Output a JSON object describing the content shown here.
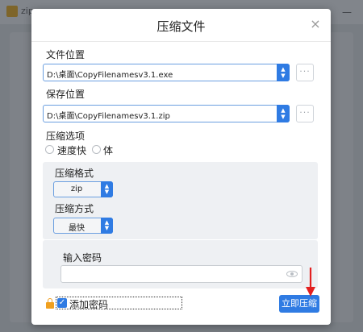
{
  "background": {
    "app_title": "zip"
  },
  "dialog": {
    "title": "压缩文件",
    "close_glyph": "×",
    "file_location": {
      "label": "文件位置",
      "value": "D:\\桌面\\CopyFilenamesv3.1.exe",
      "browse_label": "···"
    },
    "save_location": {
      "label": "保存位置",
      "value": "D:\\桌面\\CopyFilenamesv3.1.zip",
      "browse_label": "···"
    },
    "options": {
      "label": "压缩选项",
      "radio_fast": "速度快",
      "radio_small": "体"
    },
    "format": {
      "label": "压缩格式",
      "value": "zip"
    },
    "method": {
      "label": "压缩方式",
      "value": "最快"
    },
    "password": {
      "label": "输入密码",
      "value": ""
    },
    "add_password": {
      "label": "添加密码",
      "checked": true
    },
    "compress_button": "立即压缩"
  },
  "colors": {
    "accent": "#2f7be3",
    "annotation_arrow": "#e32020",
    "lock": "#f0a020"
  },
  "icons": {
    "close": "close-icon",
    "dropdown": "chevron-updown-icon",
    "eye": "eye-icon",
    "lock": "lock-icon",
    "check": "check-icon"
  }
}
